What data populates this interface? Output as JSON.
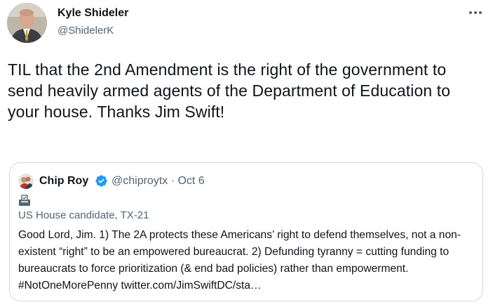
{
  "author": {
    "name": "Kyle Shideler",
    "handle": "@ShidelerK"
  },
  "tweet": {
    "text": "TIL that the 2nd Amendment is the right of the government to send heavily armed agents of the Department of Education to your house. Thanks Jim Swift!"
  },
  "quoted": {
    "name": "Chip Roy",
    "handle_date": "@chiproytx · Oct 6",
    "label": "US House candidate, TX-21",
    "text": "Good Lord, Jim. 1) The 2A protects these Americans’ right to defend themselves, not a non-existent “right” to be an empowered bureaucrat. 2) Defunding tyranny = cutting funding to bureaucrats to force prioritization (& end bad policies) rather than empowerment. #NotOneMorePenny twitter.com/JimSwiftDC/sta…"
  },
  "colors": {
    "primary_text": "#0f1419",
    "secondary_text": "#536471",
    "verified": "#1d9bf0",
    "border": "#cfd9de"
  },
  "icons": {
    "more": "more-icon",
    "verified": "verified-badge-icon",
    "label": "ballot-box-icon"
  }
}
